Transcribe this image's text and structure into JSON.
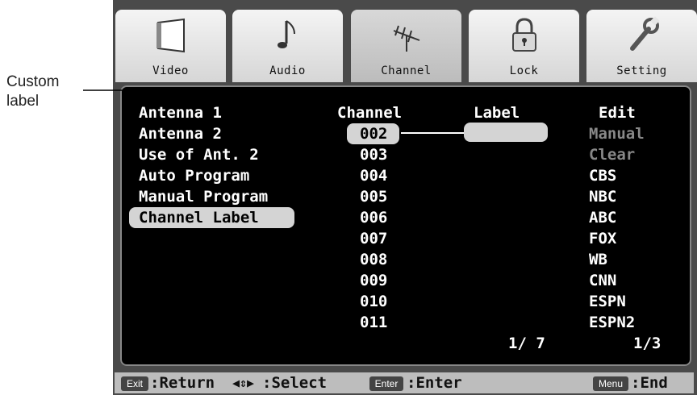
{
  "callout": {
    "line1": "Custom",
    "line2": "label"
  },
  "tabs": [
    {
      "label": "Video",
      "icon": "video-icon"
    },
    {
      "label": "Audio",
      "icon": "music-note-icon"
    },
    {
      "label": "Channel",
      "icon": "antenna-icon",
      "active": true
    },
    {
      "label": "Lock",
      "icon": "lock-icon"
    },
    {
      "label": "Setting",
      "icon": "wrench-icon"
    }
  ],
  "menu": [
    "Antenna 1",
    "Antenna 2",
    "Use of Ant. 2",
    "Auto Program",
    "Manual Program",
    "Channel Label"
  ],
  "menu_selected": "Channel Label",
  "columns": {
    "channel": "Channel",
    "label": "Label",
    "edit": "Edit"
  },
  "channels": [
    "002",
    "003",
    "004",
    "005",
    "006",
    "007",
    "008",
    "009",
    "010",
    "011"
  ],
  "edit_values": [
    "Manual",
    "Clear",
    "CBS",
    "NBC",
    "ABC",
    "FOX",
    "WB",
    "CNN",
    "ESPN",
    "ESPN2"
  ],
  "label_value": "",
  "channel_page": "1/ 7",
  "edit_page": "1/3",
  "status": {
    "exit_key": "Exit",
    "return": ":Return",
    "select": ":Select",
    "enter_key": "Enter",
    "enter": ":Enter",
    "menu_key": "Menu",
    "end": ":End"
  }
}
